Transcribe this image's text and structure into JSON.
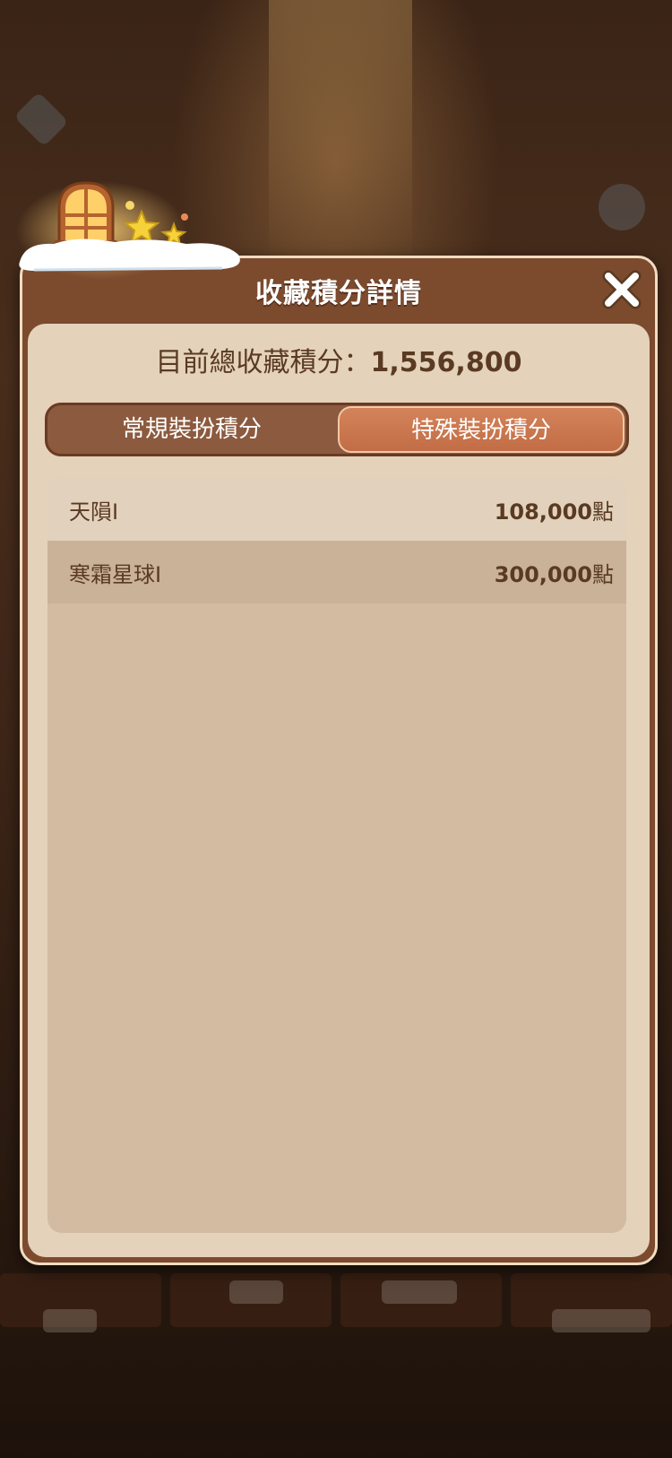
{
  "dialog": {
    "title": "收藏積分詳情",
    "close_icon": "close-icon"
  },
  "summary": {
    "label": "目前總收藏積分：",
    "value": "1,556,800"
  },
  "tabs": [
    {
      "label": "常規裝扮積分",
      "selected": false
    },
    {
      "label": "特殊裝扮積分",
      "selected": true
    }
  ],
  "items": [
    {
      "name": "天隕Ⅰ",
      "points": "108,000",
      "unit": "點"
    },
    {
      "name": "寒霜星球Ⅰ",
      "points": "300,000",
      "unit": "點"
    }
  ],
  "colors": {
    "frame": "#7c4a2d",
    "panel": "#e4d2bb",
    "active_tab": "#c97549",
    "text": "#5a3a22"
  }
}
